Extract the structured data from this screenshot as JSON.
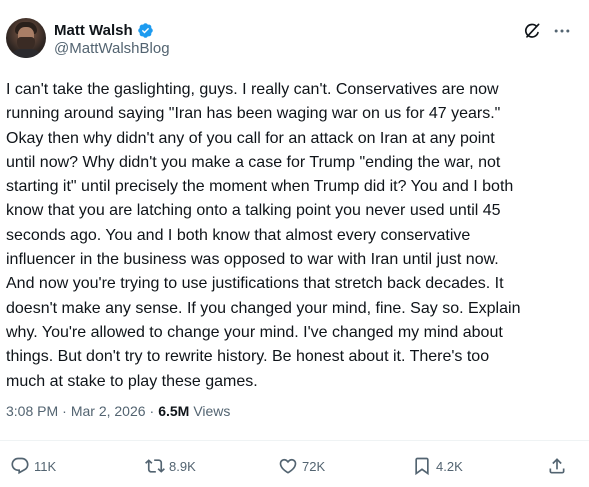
{
  "author": {
    "name": "Matt Walsh",
    "handle": "@MattWalshBlog",
    "verified": true
  },
  "header_icons": {
    "grok": "grok-icon",
    "more": "more-icon"
  },
  "tweet": {
    "lines": [
      "I can't take the gaslighting, guys. I really can't. Conservatives are now",
      "running around saying \"Iran has been waging war on us for 47 years.\"",
      "Okay then why didn't any of you call for an attack on Iran at any point",
      "until now? Why didn't you make a case for Trump \"ending the war, not",
      "starting it\" until precisely the moment when Trump did it? You and I both",
      "know that you are latching onto a talking point you never used until 45",
      "seconds ago. You and I both know that almost every conservative",
      "influencer in the business was opposed to war with Iran until just now.",
      "And now you're trying to use justifications that stretch back decades. It",
      "doesn't make any sense. If you changed your mind, fine. Say so. Explain",
      "why. You're allowed to change your mind. I've changed my mind about",
      "things. But don't try to rewrite history. Be honest about it. There's too",
      "much at stake to play these games."
    ]
  },
  "meta": {
    "time": "3:08 PM",
    "separator": "·",
    "date": "Mar 2, 2026",
    "views_count": "6.5M",
    "views_label": "Views"
  },
  "actions": {
    "reply": {
      "count": "11K",
      "icon": "reply-icon"
    },
    "repost": {
      "count": "8.9K",
      "icon": "repost-icon"
    },
    "like": {
      "count": "72K",
      "icon": "like-icon"
    },
    "bookmark": {
      "count": "4.2K",
      "icon": "bookmark-icon"
    },
    "share": {
      "icon": "share-icon"
    }
  },
  "colors": {
    "text": "#0f1419",
    "secondary": "#536471",
    "verified": "#1d9bf0",
    "divider": "#eff3f4"
  }
}
